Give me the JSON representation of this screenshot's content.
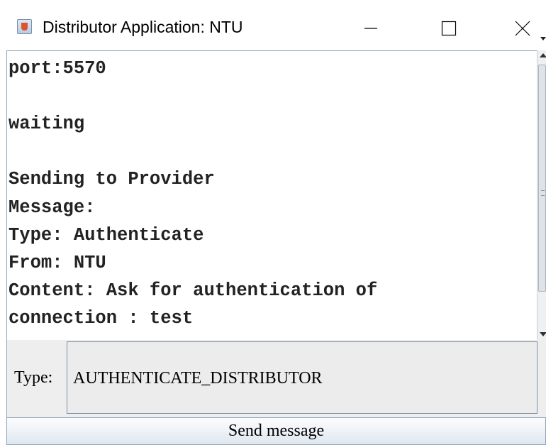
{
  "window": {
    "title": "Distributor Application: NTU",
    "icon": "java-coffee-cup-icon",
    "controls": [
      "minimize-icon",
      "maximize-icon",
      "close-icon"
    ]
  },
  "log": {
    "lines": [
      "port:5570",
      "",
      "waiting",
      "",
      "Sending to Provider",
      "Message:",
      "Type: Authenticate",
      "From: NTU",
      "Content: Ask for authentication of",
      "connection : test"
    ]
  },
  "form": {
    "type_label": "Type:",
    "type_value": "AUTHENTICATE_DISTRIBUTOR",
    "send_label": "Send message"
  }
}
